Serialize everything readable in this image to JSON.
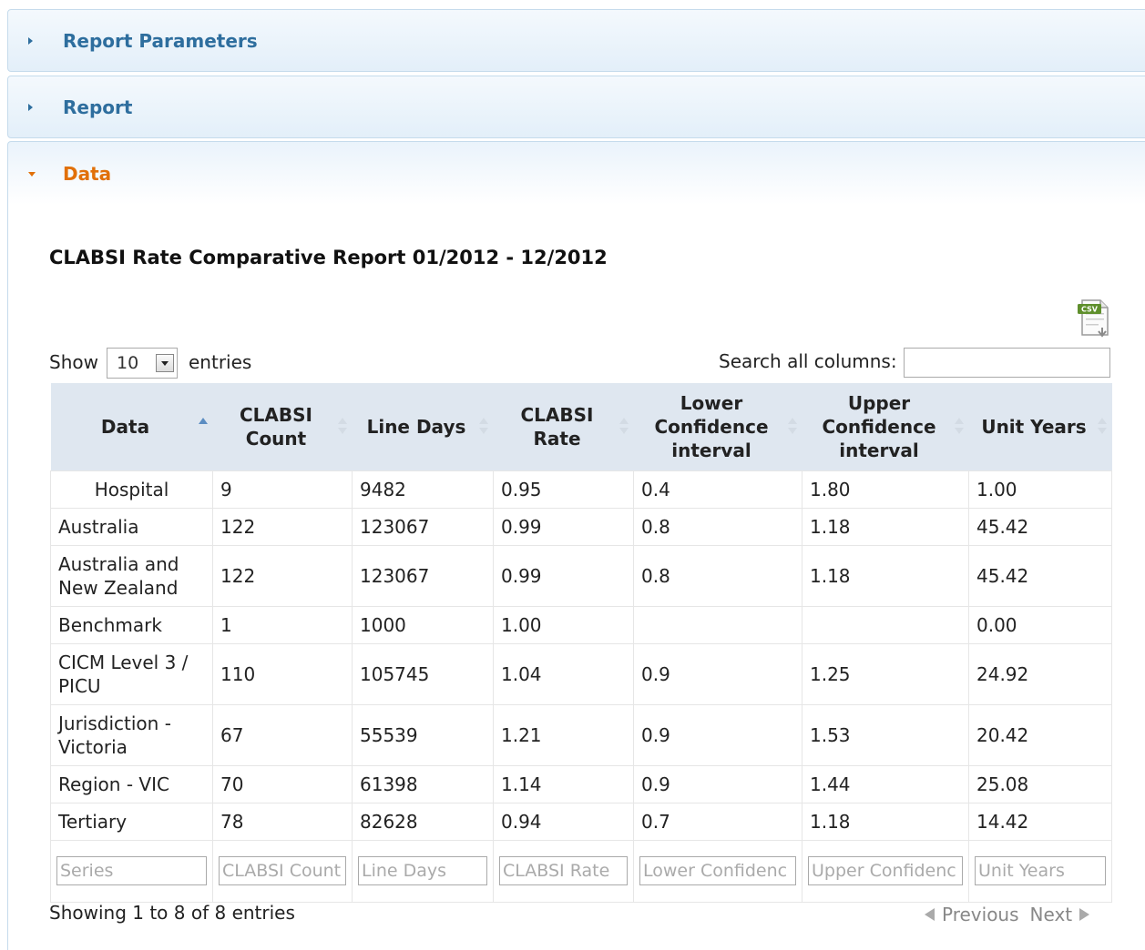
{
  "accordion": {
    "section1": "Report Parameters",
    "section2": "Report",
    "section3": "Data"
  },
  "report_title": "CLABSI Rate Comparative Report 01/2012 - 12/2012",
  "csv_icon_label": "CSV",
  "length": {
    "show": "Show",
    "value": "10",
    "entries": "entries"
  },
  "search": {
    "label": "Search all columns:"
  },
  "columns": [
    "Data",
    "CLABSI Count",
    "Line Days",
    "CLABSI Rate",
    "Lower Confidence interval",
    "Upper Confidence interval",
    "Unit Years"
  ],
  "rows": [
    [
      "Hospital",
      "9",
      "9482",
      "0.95",
      "0.4",
      "1.80",
      "1.00"
    ],
    [
      "Australia",
      "122",
      "123067",
      "0.99",
      "0.8",
      "1.18",
      "45.42"
    ],
    [
      "Australia and New Zealand",
      "122",
      "123067",
      "0.99",
      "0.8",
      "1.18",
      "45.42"
    ],
    [
      "Benchmark",
      "1",
      "1000",
      "1.00",
      "",
      "",
      "0.00"
    ],
    [
      "CICM Level 3 / PICU",
      "110",
      "105745",
      "1.04",
      "0.9",
      "1.25",
      "24.92"
    ],
    [
      "Jurisdiction - Victoria",
      "67",
      "55539",
      "1.21",
      "0.9",
      "1.53",
      "20.42"
    ],
    [
      "Region - VIC",
      "70",
      "61398",
      "1.14",
      "0.9",
      "1.44",
      "25.08"
    ],
    [
      "Tertiary",
      "78",
      "82628",
      "0.94",
      "0.7",
      "1.18",
      "14.42"
    ]
  ],
  "filters": [
    "Series",
    "CLABSI Count",
    "Line Days",
    "CLABSI Rate",
    "Lower Confidenc",
    "Upper Confidenc",
    "Unit Years"
  ],
  "info": "Showing 1 to 8 of 8 entries",
  "paging": {
    "previous": "Previous",
    "next": "Next"
  }
}
